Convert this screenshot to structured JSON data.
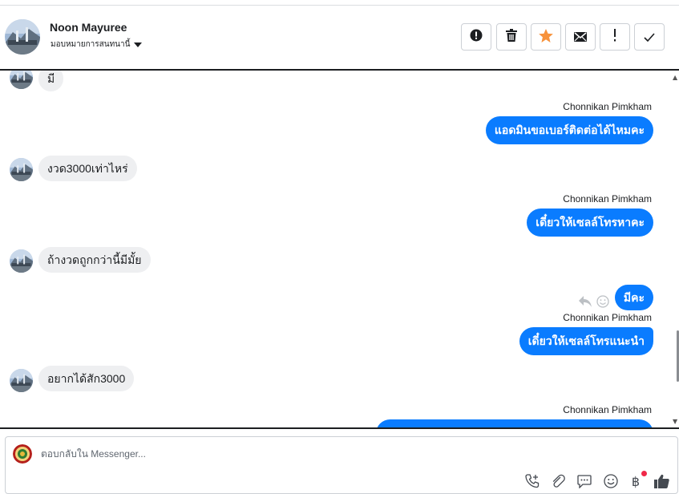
{
  "header": {
    "contact_name": "Noon Mayuree",
    "assign_label": "มอบหมายการสนทนานี้"
  },
  "toolbar": {
    "buttons": [
      {
        "name": "spam-alert-button",
        "icon": "exclamation-circle-icon"
      },
      {
        "name": "delete-button",
        "icon": "trash-icon"
      },
      {
        "name": "star-button",
        "icon": "star-icon",
        "color": "#f7923b"
      },
      {
        "name": "mark-unread-button",
        "icon": "envelope-icon"
      },
      {
        "name": "follow-up-button",
        "icon": "exclamation-icon"
      },
      {
        "name": "mark-done-button",
        "icon": "checkmark-icon"
      }
    ]
  },
  "messages": [
    {
      "direction": "in",
      "text": "มี"
    },
    {
      "direction": "out",
      "sender": "Chonnikan Pimkham",
      "text": "แอดมินขอเบอร์ติดต่อได้ไหมคะ"
    },
    {
      "direction": "in",
      "text": "งวด3000เท่าไหร่"
    },
    {
      "direction": "out",
      "sender": "Chonnikan Pimkham",
      "text": "เดี๋ยวให้เซลล์โทรหาคะ"
    },
    {
      "direction": "in",
      "text": "ถ้างวดถูกกว่านี้มีมั้ย"
    },
    {
      "direction": "out",
      "text": "มีคะ"
    },
    {
      "direction": "out",
      "sender": "Chonnikan Pimkham",
      "text": "เดี๋ยวให้เซลล์โทรแนะนำ"
    },
    {
      "direction": "in",
      "text": "อยากได้สัก3000"
    },
    {
      "direction": "out",
      "sender": "Chonnikan Pimkham",
      "text": ""
    }
  ],
  "composer": {
    "placeholder": "ตอบกลับใน Messenger...",
    "icons": [
      "add-call-icon",
      "attachment-icon",
      "saved-reply-icon",
      "emoji-icon",
      "baht-payment-icon",
      "thumbs-up-icon"
    ]
  },
  "colors": {
    "outgoing_bubble": "#0a7cff",
    "incoming_bubble": "#eeeff1",
    "star": "#f7923b",
    "notification_dot": "#f02849"
  }
}
